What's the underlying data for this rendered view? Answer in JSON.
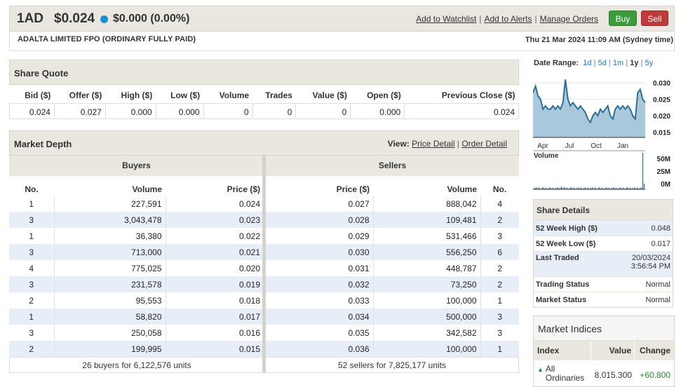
{
  "header": {
    "symbol": "1AD",
    "price": "$0.024",
    "change": "$0.000 (0.00%)",
    "links": [
      "Add to Watchlist",
      "Add to Alerts",
      "Manage Orders"
    ],
    "buy_label": "Buy",
    "sell_label": "Sell",
    "company": "ADALTA LIMITED FPO (ORDINARY FULLY PAID)",
    "datetime": "Thu 21 Mar 2024 11:09 AM (Sydney time)",
    "indicator_color": "#1a8fd6"
  },
  "share_quote": {
    "title": "Share Quote",
    "headers": [
      "Bid ($)",
      "Offer ($)",
      "High ($)",
      "Low ($)",
      "Volume",
      "Trades",
      "Value ($)",
      "Open ($)",
      "Previous Close ($)"
    ],
    "values": [
      "0.024",
      "0.027",
      "0.000",
      "0.000",
      "0",
      "0",
      "0",
      "0.000",
      "0.024"
    ]
  },
  "market_depth": {
    "title": "Market Depth",
    "view_label": "View:",
    "view_links": [
      "Price Detail",
      "Order Detail"
    ],
    "buyers_label": "Buyers",
    "sellers_label": "Sellers",
    "buyer_headers": [
      "No.",
      "Volume",
      "Price ($)"
    ],
    "seller_headers": [
      "Price ($)",
      "Volume",
      "No."
    ],
    "buyers": [
      [
        "1",
        "227,591",
        "0.024"
      ],
      [
        "3",
        "3,043,478",
        "0.023"
      ],
      [
        "1",
        "36,380",
        "0.022"
      ],
      [
        "3",
        "713,000",
        "0.021"
      ],
      [
        "4",
        "775,025",
        "0.020"
      ],
      [
        "3",
        "231,578",
        "0.019"
      ],
      [
        "2",
        "95,553",
        "0.018"
      ],
      [
        "1",
        "58,820",
        "0.017"
      ],
      [
        "3",
        "250,058",
        "0.016"
      ],
      [
        "2",
        "199,995",
        "0.015"
      ]
    ],
    "sellers": [
      [
        "0.027",
        "888,042",
        "4"
      ],
      [
        "0.028",
        "109,481",
        "2"
      ],
      [
        "0.029",
        "531,466",
        "3"
      ],
      [
        "0.030",
        "556,250",
        "6"
      ],
      [
        "0.031",
        "448,787",
        "2"
      ],
      [
        "0.032",
        "73,250",
        "2"
      ],
      [
        "0.033",
        "100,000",
        "1"
      ],
      [
        "0.034",
        "500,000",
        "3"
      ],
      [
        "0.035",
        "342,582",
        "3"
      ],
      [
        "0.036",
        "100,000",
        "1"
      ]
    ],
    "buyers_summary": "26 buyers for 6,122,576 units",
    "sellers_summary": "52 sellers for 7,825,177 units"
  },
  "chart": {
    "date_range_label": "Date Range:",
    "ranges": [
      "1d",
      "5d",
      "1m",
      "1y",
      "5y"
    ],
    "selected_range": "1y",
    "price_ticks": [
      "0.030",
      "0.025",
      "0.020",
      "0.015"
    ],
    "price_tick_values": [
      0.03,
      0.025,
      0.02,
      0.015
    ],
    "x_ticks": [
      "Apr",
      "Jul",
      "Oct",
      "Jan"
    ],
    "volume_label": "Volume",
    "volume_ticks": [
      "50M",
      "25M",
      "0M"
    ],
    "price_series": [
      0.027,
      0.029,
      0.026,
      0.025,
      0.022,
      0.023,
      0.022,
      0.022,
      0.023,
      0.022,
      0.023,
      0.022,
      0.024,
      0.031,
      0.025,
      0.023,
      0.024,
      0.023,
      0.022,
      0.023,
      0.022,
      0.021,
      0.019,
      0.018,
      0.02,
      0.021,
      0.02,
      0.022,
      0.021,
      0.022,
      0.023,
      0.02,
      0.019,
      0.022,
      0.023,
      0.022,
      0.023,
      0.022,
      0.023,
      0.022,
      0.02,
      0.019,
      0.027,
      0.028,
      0.025,
      0.024
    ],
    "line_color": "#2f6f95",
    "fill_color": "#a9c8db"
  },
  "share_details": {
    "title": "Share Details",
    "rows": [
      [
        "52 Week High ($)",
        "0.048"
      ],
      [
        "52 Week Low ($)",
        "0.017"
      ],
      [
        "Last Traded",
        "20/03/2024",
        "3:56:54 PM"
      ],
      [
        "Trading Status",
        "Normal"
      ],
      [
        "Market Status",
        "Normal"
      ]
    ]
  },
  "market_indices": {
    "title": "Market Indices",
    "headers": [
      "Index",
      "Value",
      "Change"
    ],
    "rows": [
      {
        "name_line1": "All",
        "name_line2": "Ordinaries",
        "value": "8,015.300",
        "change": "+60.800",
        "up_color": "#2d8a2d"
      }
    ]
  }
}
